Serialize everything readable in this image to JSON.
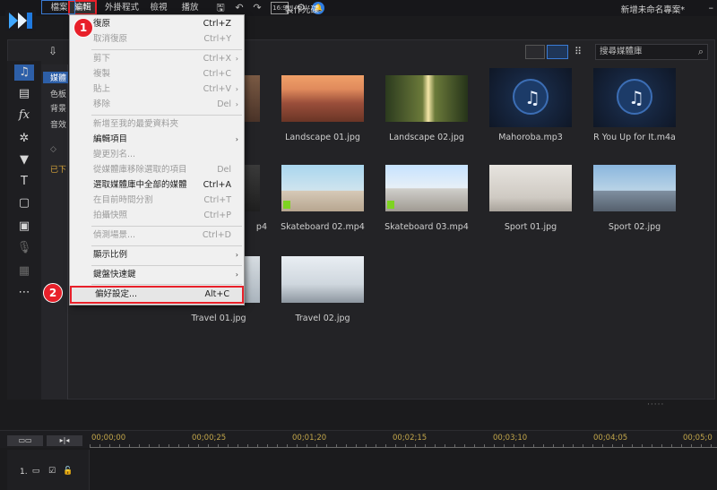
{
  "menubar": {
    "items": [
      "檔案",
      "編輯",
      "外掛程式",
      "檢視",
      "播放"
    ],
    "aspect_ratio": "16:9",
    "project_title": "新增未命名專案*"
  },
  "mode": {
    "produce_label": "製作光碟"
  },
  "tree": {
    "items": [
      "媒體",
      "色板",
      "背景",
      "音效"
    ],
    "note": "已下"
  },
  "search": {
    "placeholder": "搜尋媒體庫"
  },
  "media": [
    {
      "caption": "",
      "kind": "image"
    },
    {
      "caption": "Landscape 01.jpg",
      "kind": "image"
    },
    {
      "caption": "Landscape 02.jpg",
      "kind": "image"
    },
    {
      "caption": "Mahoroba.mp3",
      "kind": "music"
    },
    {
      "caption": "R You Up for It.m4a",
      "kind": "music"
    },
    {
      "caption": "p4",
      "kind": "video"
    },
    {
      "caption": "Skateboard 02.mp4",
      "kind": "video"
    },
    {
      "caption": "Skateboard 03.mp4",
      "kind": "video"
    },
    {
      "caption": "Sport 01.jpg",
      "kind": "image"
    },
    {
      "caption": "Sport 02.jpg",
      "kind": "image"
    },
    {
      "caption": "Travel 01.jpg",
      "kind": "image"
    },
    {
      "caption": "Travel 02.jpg",
      "kind": "image"
    }
  ],
  "edit_menu": {
    "undo": {
      "label": "復原",
      "shortcut": "Ctrl+Z"
    },
    "redo": {
      "label": "取消復原",
      "shortcut": "Ctrl+Y"
    },
    "cut": {
      "label": "剪下",
      "shortcut": "Ctrl+X"
    },
    "copy": {
      "label": "複製",
      "shortcut": "Ctrl+C"
    },
    "paste": {
      "label": "貼上",
      "shortcut": "Ctrl+V"
    },
    "remove": {
      "label": "移除",
      "shortcut": "Del"
    },
    "add_favorite": {
      "label": "新增至我的最愛資料夾"
    },
    "edit_item": {
      "label": "編輯項目"
    },
    "rename": {
      "label": "變更別名..."
    },
    "remove_selected": {
      "label": "從媒體庫移除選取的項目",
      "shortcut": "Del"
    },
    "select_all": {
      "label": "選取媒體庫中全部的媒體",
      "shortcut": "Ctrl+A"
    },
    "split": {
      "label": "在目前時間分割",
      "shortcut": "Ctrl+T"
    },
    "snapshot": {
      "label": "拍攝快照",
      "shortcut": "Ctrl+P"
    },
    "detect_scene": {
      "label": "偵測場景...",
      "shortcut": "Ctrl+D"
    },
    "display_ratio": {
      "label": "顯示比例"
    },
    "keyboard": {
      "label": "鍵盤快速鍵"
    },
    "preferences": {
      "label": "偏好設定...",
      "shortcut": "Alt+C"
    }
  },
  "badges": {
    "one": "1",
    "two": "2"
  },
  "timeline": {
    "btn1": "▭▭",
    "btn2": "▸|◂",
    "timestamps": [
      "00;00;00",
      "00;00;25",
      "00;01;20",
      "00;02;15",
      "00;03;10",
      "00;04;05",
      "00;05;0"
    ],
    "track_number": "1."
  },
  "colors": {
    "accent": "#3a7bd5",
    "highlight": "#e8202a"
  }
}
